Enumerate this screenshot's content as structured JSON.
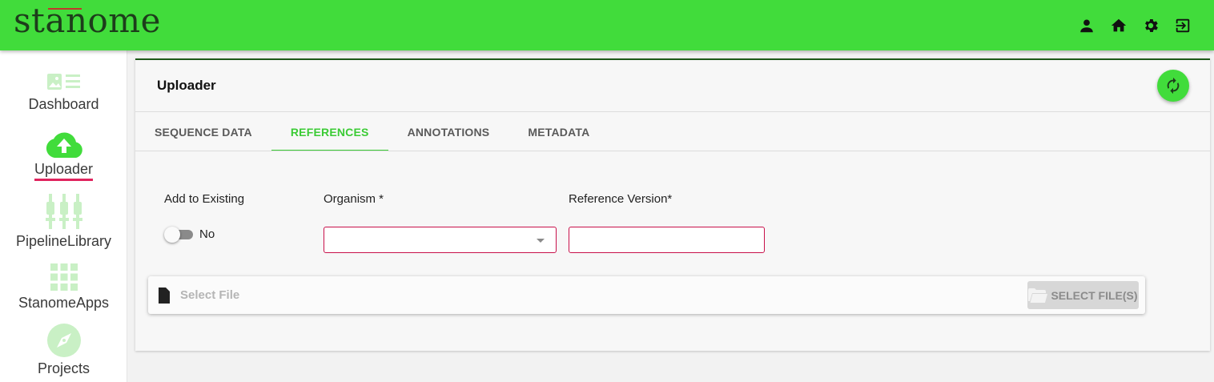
{
  "header": {
    "logo": "stanome",
    "icons": [
      "person-icon",
      "home-icon",
      "gear-icon",
      "logout-icon"
    ]
  },
  "sidebar": {
    "items": [
      {
        "label": "Dashboard",
        "icon": "dashboard-icon"
      },
      {
        "label": "Uploader",
        "icon": "cloud-upload-icon",
        "active": true
      },
      {
        "label": "PipelineLibrary",
        "icon": "pipeline-icon"
      },
      {
        "label": "StanomeApps",
        "icon": "apps-grid-icon"
      },
      {
        "label": "Projects",
        "icon": "compass-icon"
      }
    ]
  },
  "main": {
    "title": "Uploader",
    "tabs": [
      {
        "label": "SEQUENCE DATA"
      },
      {
        "label": "REFERENCES",
        "active": true
      },
      {
        "label": "ANNOTATIONS"
      },
      {
        "label": "METADATA"
      }
    ],
    "form": {
      "add_existing_label": "Add to Existing",
      "add_existing_value": "No",
      "organism_label": "Organism *",
      "organism_value": "",
      "reference_version_label": "Reference Version*",
      "reference_version_value": ""
    },
    "file": {
      "placeholder": "Select File",
      "button_label": "SELECT FILE(S)"
    }
  },
  "colors": {
    "brand_green": "#41dc3b",
    "active_tab": "#3bcb35",
    "error_border": "#c8104a",
    "active_underline": "#e0245e",
    "sidebar_icon_light": "#c9f0c5"
  }
}
